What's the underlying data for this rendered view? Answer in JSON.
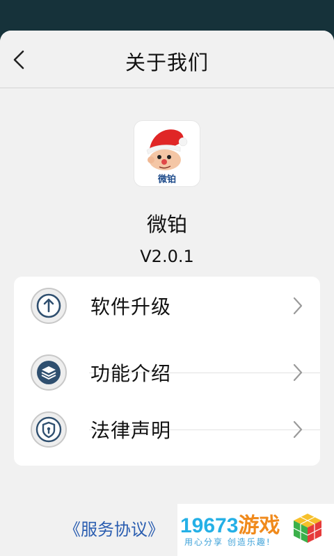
{
  "header": {
    "title": "关于我们",
    "back_icon": "chevron-left-icon"
  },
  "app": {
    "name": "微铂",
    "version": "V2.0.1",
    "icon_text": "微铂"
  },
  "menu": {
    "items": [
      {
        "label": "软件升级",
        "icon": "upgrade-arrow-icon"
      },
      {
        "label": "功能介绍",
        "icon": "layers-icon"
      },
      {
        "label": "法律声明",
        "icon": "shield-icon"
      }
    ]
  },
  "footer": {
    "link": "《服务协议》"
  },
  "watermark": {
    "number": "19673",
    "title_cn": "游戏",
    "slogan": "用心分享  创造乐趣!"
  },
  "colors": {
    "background": "#f1f1f1",
    "status_bar": "#16323a",
    "link": "#2a5db0"
  }
}
